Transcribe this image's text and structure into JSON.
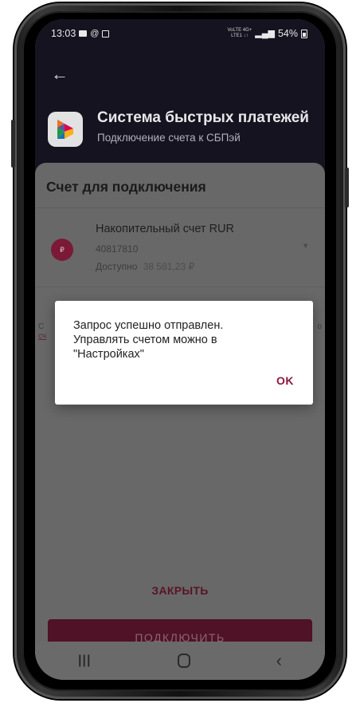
{
  "status_bar": {
    "time": "13:03",
    "network_top": "VoLTE 4G+",
    "network_bottom": "LTE1 ↓↑",
    "battery": "54%"
  },
  "header": {
    "back_icon": "arrow-left-icon",
    "logo_icon": "sbp-logo-icon",
    "title": "Система быстрых платежей",
    "subtitle": "Подключение счета к СБПэй"
  },
  "sheet": {
    "title": "Счет для подключения",
    "account": {
      "icon_text": "₽",
      "name": "Накопительный счет RUR",
      "number": "40817810",
      "available_label": "Доступно",
      "available_amount": "38 581,23 ₽"
    },
    "edge_left_1": "С",
    "edge_left_2": "сч",
    "edge_right": "о",
    "close_label": "ЗАКРЫТЬ",
    "connect_label": "ПОДКЛЮЧИТЬ"
  },
  "dialog": {
    "message_lines": [
      "Запрос успешно отправлен.",
      "Управлять счетом можно в",
      "\"Настройках\""
    ],
    "ok_label": "OK"
  },
  "nav_bar": {
    "recent_icon": "recent-apps-icon",
    "home_icon": "home-icon",
    "back_icon": "back-icon"
  },
  "colors": {
    "accent": "#8a1a3c",
    "header_bg": "#15131f",
    "dim_bg": "#686868"
  }
}
